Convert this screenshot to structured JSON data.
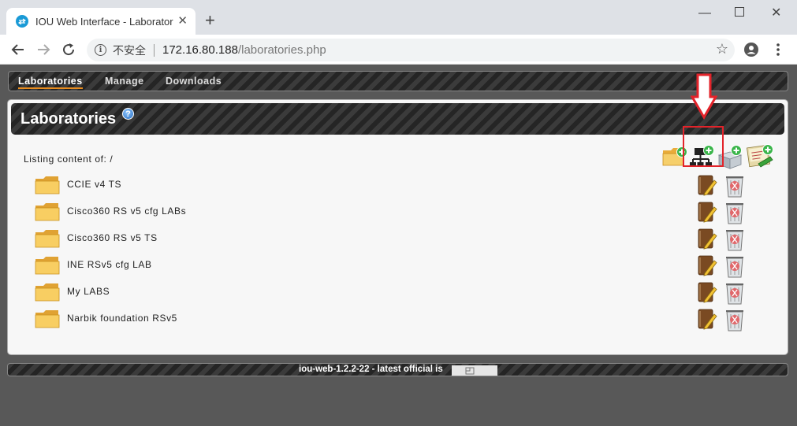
{
  "browser": {
    "tab_title": "IOU Web Interface - Laboratories",
    "security_label": "不安全",
    "url_host": "172.16.80.188",
    "url_path": "/laboratories.php"
  },
  "menu": {
    "items": [
      {
        "label": "Laboratories",
        "active": true
      },
      {
        "label": "Manage",
        "active": false
      },
      {
        "label": "Downloads",
        "active": false
      }
    ]
  },
  "panel": {
    "title": "Laboratories",
    "help_symbol": "?",
    "listing_label": "Listing content of: /"
  },
  "actions": [
    {
      "icon": "add-folder-icon"
    },
    {
      "icon": "add-lab-icon"
    },
    {
      "icon": "add-device-icon"
    },
    {
      "icon": "import-icon"
    }
  ],
  "folders": [
    {
      "name": "CCIE v4 TS"
    },
    {
      "name": "Cisco360 RS v5 cfg LABs"
    },
    {
      "name": "Cisco360 RS v5 TS"
    },
    {
      "name": "INE RSv5 cfg LAB"
    },
    {
      "name": "My LABS"
    },
    {
      "name": "Narbik foundation RSv5"
    }
  ],
  "footer": {
    "version_text": "iou-web-1.2.2-22 - latest official is"
  },
  "colors": {
    "accent": "#e88c1e",
    "highlight_box": "#e3232a"
  }
}
